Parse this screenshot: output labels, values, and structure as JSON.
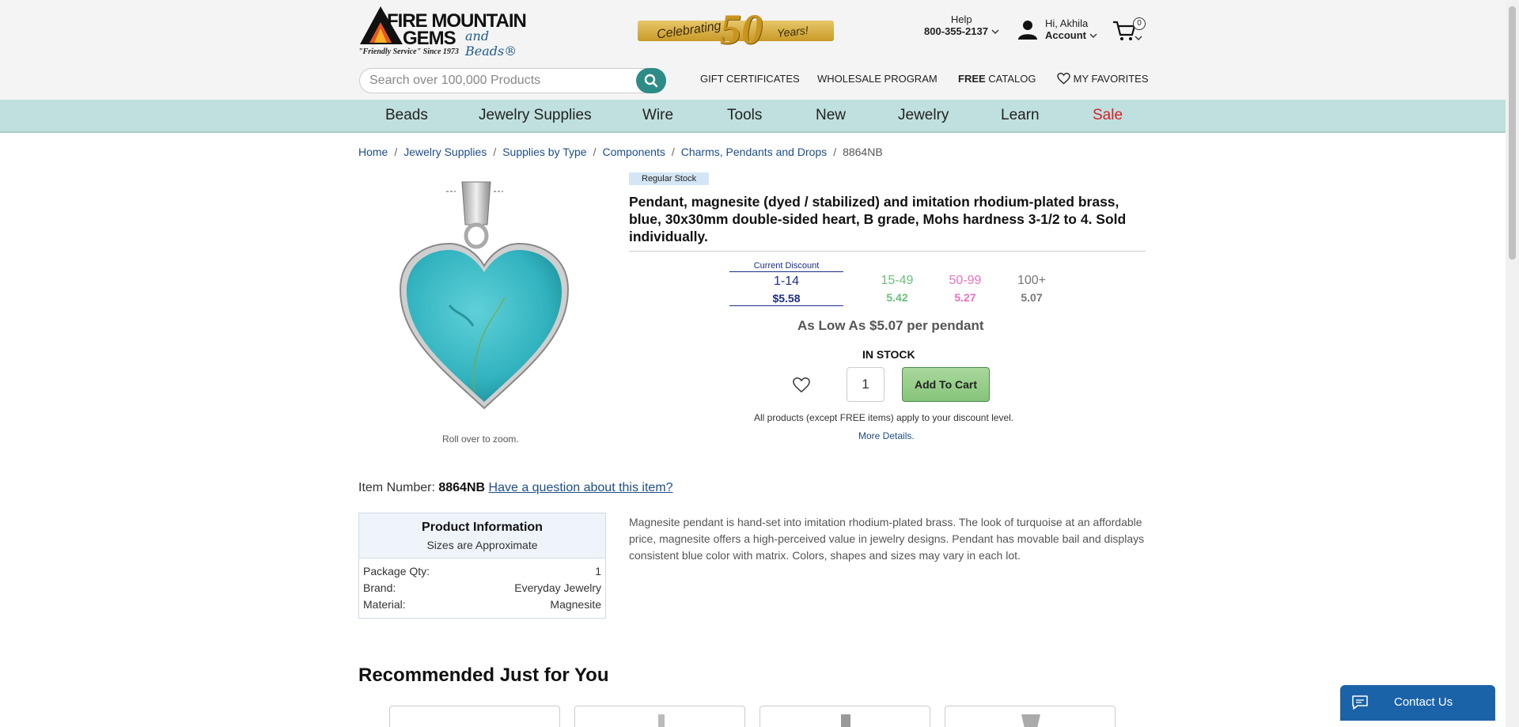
{
  "header": {
    "logo": {
      "line1": "FIRE MOUNTAIN",
      "line2": "GEMS",
      "beads": "and Beads®",
      "tagline": "\"Friendly Service\" Since 1973"
    },
    "anniversary": {
      "left": "Celebrating",
      "number": "50",
      "right": "Years!"
    },
    "help": {
      "label": "Help",
      "phone": "800-355-2137"
    },
    "account": {
      "greeting": "Hi, Akhila",
      "label": "Account"
    },
    "cart": {
      "count": "0"
    },
    "search": {
      "placeholder": "Search over 100,000 Products"
    },
    "links": {
      "gift": "GIFT CERTIFICATES",
      "wholesale": "WHOLESALE PROGRAM",
      "free": "FREE",
      "catalog": " CATALOG",
      "favorites": "MY FAVORITES"
    }
  },
  "nav": {
    "items": [
      "Beads",
      "Jewelry Supplies",
      "Wire",
      "Tools",
      "New",
      "Jewelry",
      "Learn",
      "Sale"
    ]
  },
  "breadcrumb": [
    "Home",
    "Jewelry Supplies",
    "Supplies by Type",
    "Components",
    "Charms, Pendants and Drops",
    "8864NB"
  ],
  "product": {
    "image_hint": "Roll over to zoom.",
    "stock_badge": "Regular Stock",
    "title": "Pendant, magnesite (dyed / stabilized) and imitation rhodium-plated brass, blue, 30x30mm double-sided heart, B grade, Mohs hardness 3-1/2 to 4. Sold individually.",
    "current_discount_label": "Current Discount",
    "price_tiers": [
      {
        "qty": "1-14",
        "price": "$5.58",
        "color": "#1d2d8c"
      },
      {
        "qty": "15-49",
        "price": "5.42",
        "color": "#6cbf7c"
      },
      {
        "qty": "50-99",
        "price": "5.27",
        "color": "#ef6fc0"
      },
      {
        "qty": "100+",
        "price": "5.07",
        "color": "#777777"
      }
    ],
    "low_price": "As Low As $5.07 per pendant",
    "stock_status": "IN STOCK",
    "quantity": "1",
    "add_to_cart": "Add To Cart",
    "discount_note": "All products (except FREE items) apply to your discount level.",
    "more_details": "More Details.",
    "item_number_label": "Item Number: ",
    "item_number": "8864NB",
    "question_link": "Have a question about this item?",
    "info": {
      "title": "Product Information",
      "subtitle": "Sizes are Approximate",
      "rows": [
        {
          "label": "Package Qty:",
          "value": "1"
        },
        {
          "label": "Brand:",
          "value": "Everyday Jewelry"
        },
        {
          "label": "Material:",
          "value": "Magnesite"
        }
      ]
    },
    "description": "Magnesite pendant is hand-set into imitation rhodium-plated brass. The look of turquoise at an affordable price, magnesite offers a high-perceived value in jewelry designs. Pendant has movable bail and displays consistent blue color with matrix. Colors, shapes and sizes may vary in each lot."
  },
  "recommended": {
    "title": "Recommended Just for You"
  },
  "contact": {
    "label": "Contact Us"
  },
  "colors": {
    "nav_bg": "#bfe0de",
    "search_btn": "#2d8c86",
    "sale": "#d9202a",
    "link": "#1d4d8c",
    "contact_bg": "#1b63a9"
  }
}
